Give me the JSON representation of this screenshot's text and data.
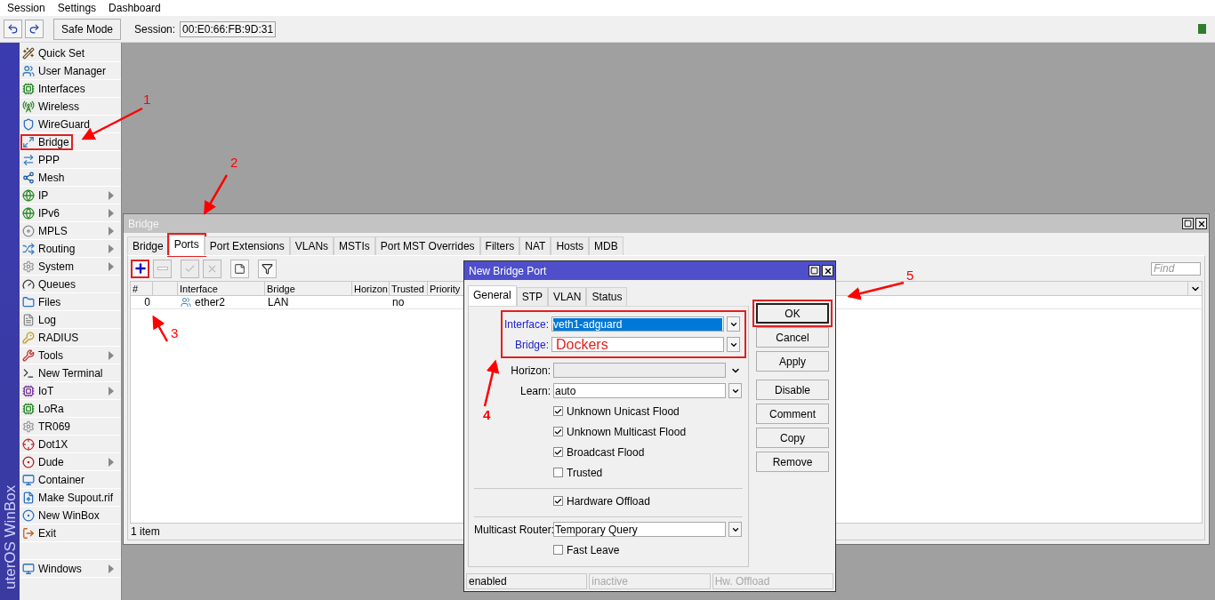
{
  "menu": [
    "Session",
    "Settings",
    "Dashboard"
  ],
  "toolbar": {
    "safe_mode": "Safe Mode",
    "session_label": "Session:",
    "session_value": "00:E0:66:FB:9D:31",
    "connected": true
  },
  "sidebar": {
    "brand": "uterOS WinBox",
    "items": [
      {
        "label": "Quick Set",
        "submenu": false,
        "annotated": false
      },
      {
        "label": "User Manager",
        "submenu": false,
        "annotated": false
      },
      {
        "label": "Interfaces",
        "submenu": false,
        "annotated": false
      },
      {
        "label": "Wireless",
        "submenu": false,
        "annotated": false
      },
      {
        "label": "WireGuard",
        "submenu": false,
        "annotated": false
      },
      {
        "label": "Bridge",
        "submenu": false,
        "annotated": true
      },
      {
        "label": "PPP",
        "submenu": false,
        "annotated": false
      },
      {
        "label": "Mesh",
        "submenu": false,
        "annotated": false
      },
      {
        "label": "IP",
        "submenu": true,
        "annotated": false
      },
      {
        "label": "IPv6",
        "submenu": true,
        "annotated": false
      },
      {
        "label": "MPLS",
        "submenu": true,
        "annotated": false
      },
      {
        "label": "Routing",
        "submenu": true,
        "annotated": false
      },
      {
        "label": "System",
        "submenu": true,
        "annotated": false
      },
      {
        "label": "Queues",
        "submenu": false,
        "annotated": false
      },
      {
        "label": "Files",
        "submenu": false,
        "annotated": false
      },
      {
        "label": "Log",
        "submenu": false,
        "annotated": false
      },
      {
        "label": "RADIUS",
        "submenu": false,
        "annotated": false
      },
      {
        "label": "Tools",
        "submenu": true,
        "annotated": false
      },
      {
        "label": "New Terminal",
        "submenu": false,
        "annotated": false
      },
      {
        "label": "IoT",
        "submenu": true,
        "annotated": false
      },
      {
        "label": "LoRa",
        "submenu": false,
        "annotated": false
      },
      {
        "label": "TR069",
        "submenu": false,
        "annotated": false
      },
      {
        "label": "Dot1X",
        "submenu": false,
        "annotated": false
      },
      {
        "label": "Dude",
        "submenu": true,
        "annotated": false
      },
      {
        "label": "Container",
        "submenu": false,
        "annotated": false
      },
      {
        "label": "Make Supout.rif",
        "submenu": false,
        "annotated": false
      },
      {
        "label": "New WinBox",
        "submenu": false,
        "annotated": false
      },
      {
        "label": "Exit",
        "submenu": false,
        "annotated": false
      }
    ],
    "bottom_items": [
      {
        "label": "Windows",
        "submenu": true,
        "annotated": false
      }
    ]
  },
  "bridge_window": {
    "title": "Bridge",
    "tabs": [
      {
        "label": "Bridge",
        "selected": false,
        "annotated": false
      },
      {
        "label": "Ports",
        "selected": true,
        "annotated": true
      },
      {
        "label": "Port Extensions",
        "selected": false,
        "annotated": false
      },
      {
        "label": "VLANs",
        "selected": false,
        "annotated": false
      },
      {
        "label": "MSTIs",
        "selected": false,
        "annotated": false
      },
      {
        "label": "Port MST Overrides",
        "selected": false,
        "annotated": false
      },
      {
        "label": "Filters",
        "selected": false,
        "annotated": false
      },
      {
        "label": "NAT",
        "selected": false,
        "annotated": false
      },
      {
        "label": "Hosts",
        "selected": false,
        "annotated": false
      },
      {
        "label": "MDB",
        "selected": false,
        "annotated": false
      }
    ],
    "toolbar": [
      {
        "kind": "add",
        "disabled": false,
        "annotated": true
      },
      {
        "kind": "remove",
        "disabled": true,
        "annotated": false
      },
      {
        "kind": "enable",
        "disabled": true,
        "annotated": false
      },
      {
        "kind": "disable",
        "disabled": true,
        "annotated": false
      },
      {
        "kind": "comment",
        "disabled": false,
        "annotated": false
      },
      {
        "kind": "filter",
        "disabled": false,
        "annotated": false
      }
    ],
    "find": {
      "placeholder": "Find"
    },
    "table": {
      "columns": [
        "#",
        "Interface",
        "Bridge",
        "Horizon",
        "Trusted",
        "Priority"
      ],
      "rows": [
        {
          "number": "0",
          "interface": "ether2",
          "bridge": "LAN",
          "trusted": "no"
        }
      ]
    },
    "status": "1 item"
  },
  "dialog": {
    "title": "New Bridge Port",
    "tabs": [
      {
        "label": "General",
        "selected": true
      },
      {
        "label": "STP",
        "selected": false
      },
      {
        "label": "VLAN",
        "selected": false
      },
      {
        "label": "Status",
        "selected": false
      }
    ],
    "groups": [
      {
        "annotated": true,
        "fields": [
          {
            "kind": "select",
            "label": "Interface:",
            "label_link": true,
            "value": "veth1-adguard",
            "highlighted": true,
            "handwritten": false
          },
          {
            "kind": "select",
            "label": "Bridge:",
            "label_link": true,
            "value": "Dockers",
            "highlighted": false,
            "handwritten": true
          }
        ]
      },
      {
        "annotated": false,
        "fields": [
          {
            "kind": "combo",
            "label": "Horizon:",
            "label_link": false
          },
          {
            "kind": "select",
            "label": "Learn:",
            "label_link": false,
            "value": "auto",
            "highlighted": false,
            "handwritten": false
          },
          {
            "kind": "checkbox",
            "label": "Unknown Unicast Flood",
            "checked": true
          },
          {
            "kind": "checkbox",
            "label": "Unknown Multicast Flood",
            "checked": true
          },
          {
            "kind": "checkbox",
            "label": "Broadcast Flood",
            "checked": true
          },
          {
            "kind": "checkbox",
            "label": "Trusted",
            "checked": false
          }
        ]
      },
      {
        "annotated": false,
        "fields": [
          {
            "kind": "checkbox",
            "label": "Hardware Offload",
            "checked": true
          }
        ]
      },
      {
        "annotated": false,
        "fields": [
          {
            "kind": "select",
            "label": "Multicast Router:",
            "label_link": false,
            "value": "Temporary Query",
            "highlighted": false,
            "handwritten": false
          },
          {
            "kind": "checkbox",
            "label": "Fast Leave",
            "checked": false
          }
        ]
      }
    ],
    "buttons": [
      {
        "label": "OK",
        "focused": true,
        "annotated": true
      },
      {
        "label": "Cancel",
        "focused": false,
        "annotated": false
      },
      {
        "label": "Apply",
        "focused": false,
        "annotated": false
      },
      {
        "label": "Disable",
        "focused": false,
        "annotated": false
      },
      {
        "label": "Comment",
        "focused": false,
        "annotated": false
      },
      {
        "label": "Copy",
        "focused": false,
        "annotated": false
      },
      {
        "label": "Remove",
        "focused": false,
        "annotated": false
      }
    ],
    "status": [
      {
        "text": "enabled",
        "disabled": false
      },
      {
        "text": "inactive",
        "disabled": true
      },
      {
        "text": "Hw. Offload",
        "disabled": true
      }
    ]
  },
  "annotations": [
    "1",
    "2",
    "3",
    "4",
    "5"
  ]
}
